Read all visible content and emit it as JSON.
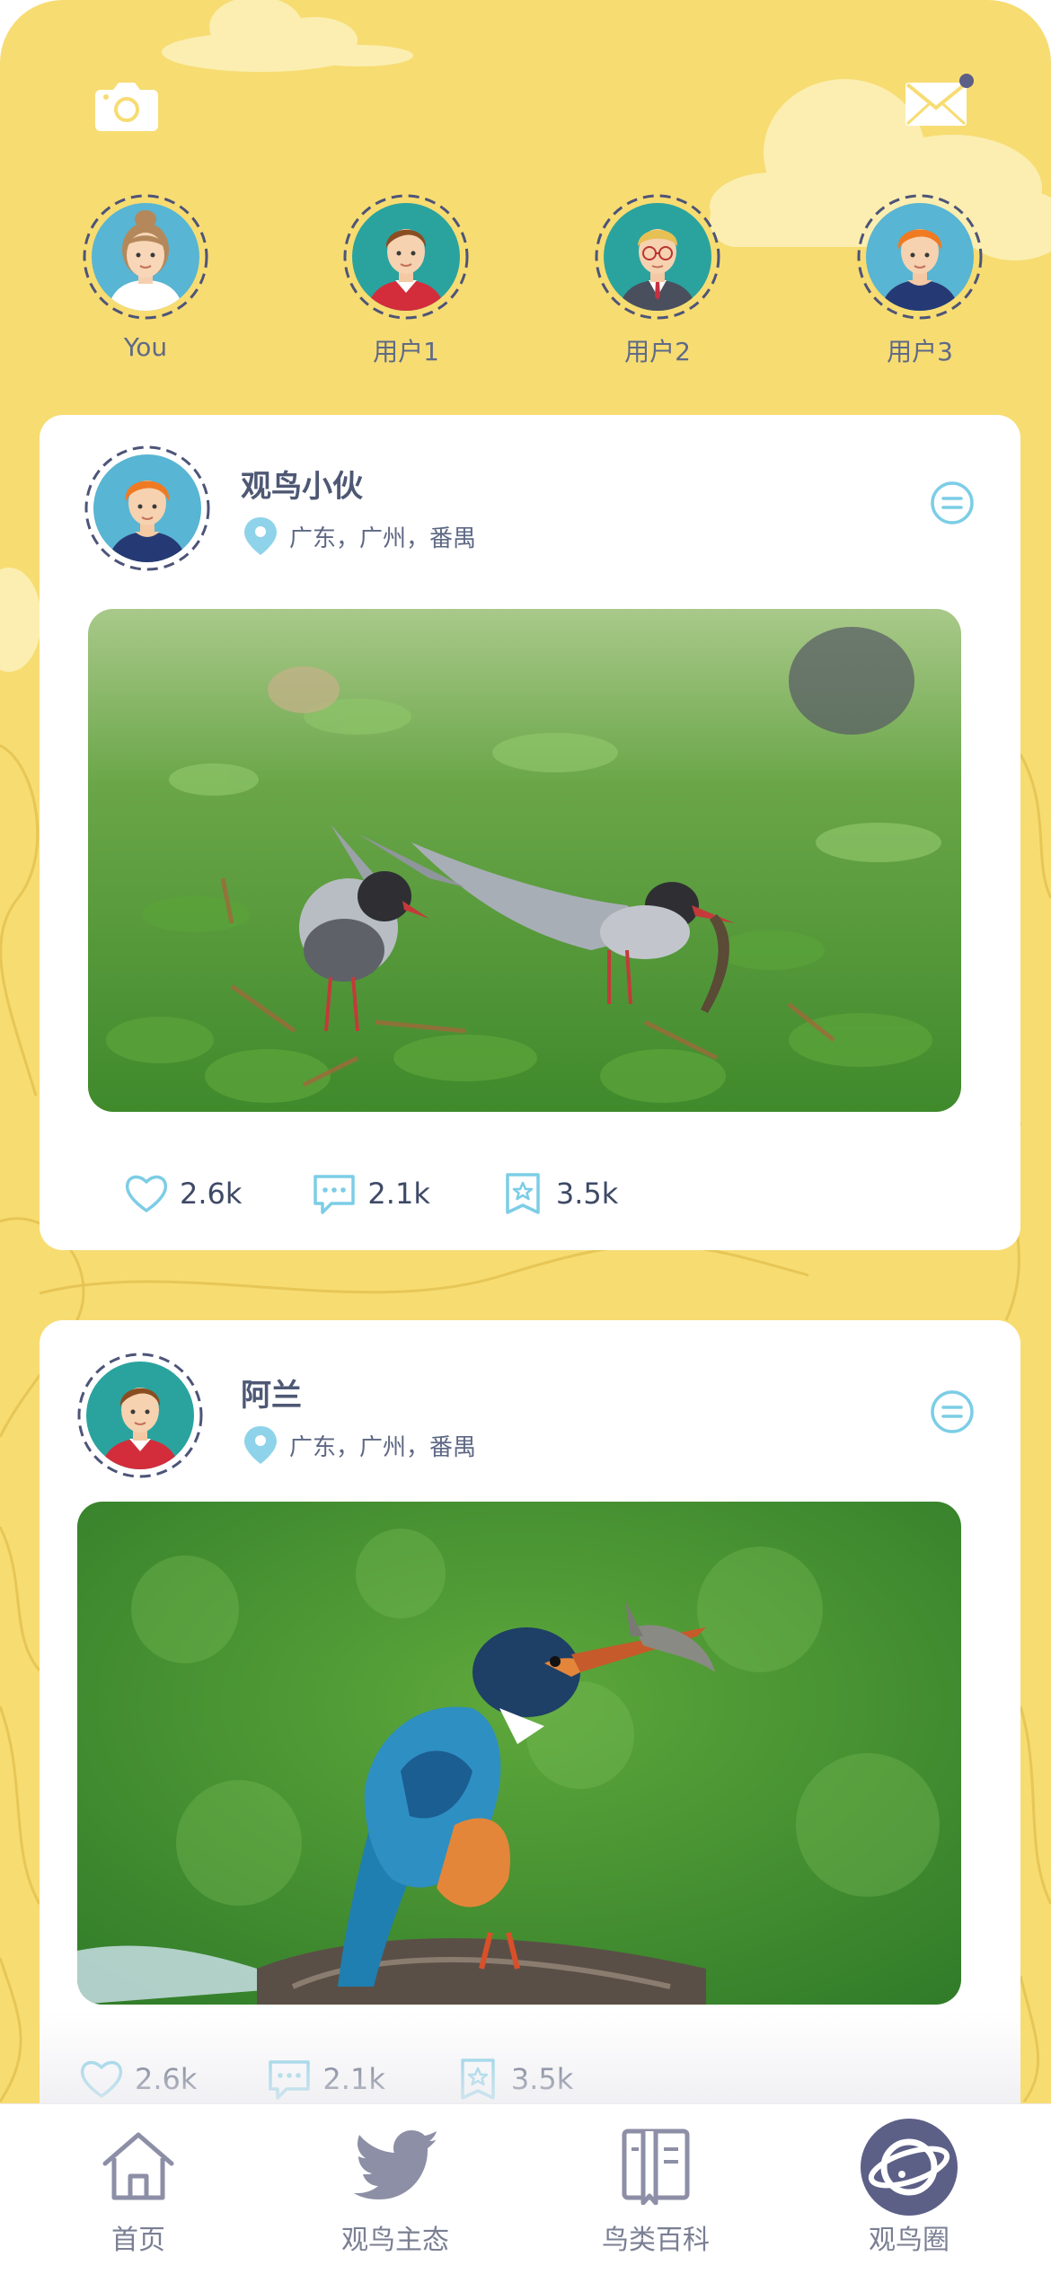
{
  "colors": {
    "background": "#f7dc72",
    "card": "#ffffff",
    "accent_blue": "#7ccde6",
    "text_dark": "#4e5874",
    "icon_gray": "#8c8fa6",
    "active_tab": "#5c5f86"
  },
  "header": {
    "camera_icon": "camera-icon",
    "mail_icon": "mail-icon",
    "has_unread": true
  },
  "stories": [
    {
      "label": "You",
      "avatar": "woman-avatar"
    },
    {
      "label": "用户1",
      "avatar": "man-avatar"
    },
    {
      "label": "用户2",
      "avatar": "glasses-man-avatar"
    },
    {
      "label": "用户3",
      "avatar": "orange-hair-avatar"
    }
  ],
  "posts": [
    {
      "author": "观鸟小伙",
      "location": "广东，广州，番禺",
      "photo": "terns-photo",
      "likes": "2.6k",
      "comments": "2.1k",
      "favorites": "3.5k"
    },
    {
      "author": "阿兰",
      "location": "广东，广州，番禺",
      "photo": "kingfisher-photo",
      "likes": "2.6k",
      "comments": "2.1k",
      "favorites": "3.5k"
    }
  ],
  "tabbar": {
    "items": [
      {
        "label": "首页",
        "icon": "home-icon"
      },
      {
        "label": "观鸟主态",
        "icon": "bird-icon"
      },
      {
        "label": "鸟类百科",
        "icon": "book-icon"
      },
      {
        "label": "观鸟圈",
        "icon": "planet-icon"
      }
    ],
    "active_index": 3
  }
}
